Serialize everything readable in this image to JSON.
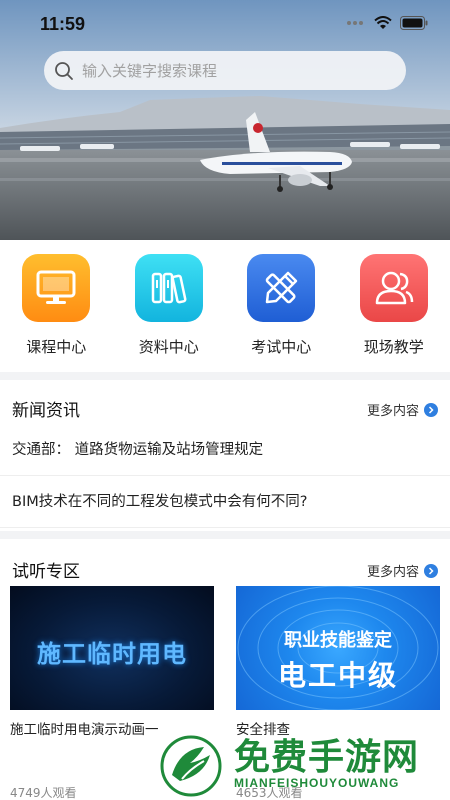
{
  "status_bar": {
    "time": "11:59"
  },
  "search": {
    "placeholder": "输入关键字搜索课程"
  },
  "categories": [
    {
      "label": "课程中心",
      "icon": "monitor-icon",
      "color": "#ff9f1a"
    },
    {
      "label": "资料中心",
      "icon": "books-icon",
      "color": "#1ec8e8"
    },
    {
      "label": "考试中心",
      "icon": "pencil-ruler-icon",
      "color": "#2d6fe0"
    },
    {
      "label": "现场教学",
      "icon": "users-icon",
      "color": "#f25a5a"
    }
  ],
  "news": {
    "title": "新闻资讯",
    "more": "更多内容",
    "items": [
      "交通部： 道路货物运输及站场管理规定",
      "BIM技术在不同的工程发包模式中会有何不同?"
    ]
  },
  "trial": {
    "title": "试听专区",
    "more": "更多内容",
    "cards": [
      {
        "thumb_text": "施工临时用电",
        "title": "施工临时用电演示动画一",
        "views": "4749人观看"
      },
      {
        "thumb_line1": "职业技能鉴定",
        "thumb_line2": "电工中级",
        "title": "安全排查",
        "views": "4653人观看"
      }
    ]
  },
  "watermark": {
    "text": "免费手游网",
    "sub": "MIANFEISHOUYOUWANG"
  }
}
